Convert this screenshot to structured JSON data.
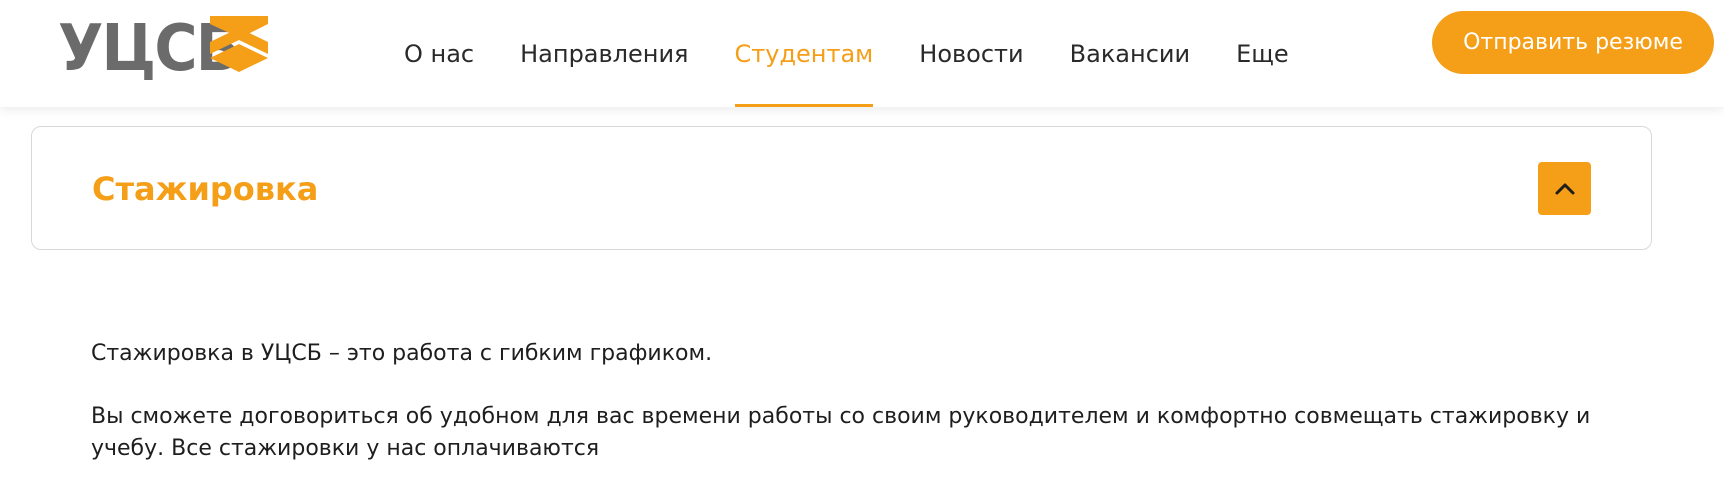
{
  "header": {
    "logo_text": "УЦСБ",
    "nav": [
      {
        "label": "О нас",
        "active": false
      },
      {
        "label": "Направления",
        "active": false
      },
      {
        "label": "Студентам",
        "active": true
      },
      {
        "label": "Новости",
        "active": false
      },
      {
        "label": "Вакансии",
        "active": false
      },
      {
        "label": "Еще",
        "active": false
      }
    ],
    "cta_label": "Отправить резюме"
  },
  "accordion": {
    "title": "Стажировка",
    "toggle_icon": "chevron-up-icon",
    "expanded": true
  },
  "content": {
    "paragraphs": [
      "Стажировка в УЦСБ – это работа с гибким графиком.",
      "Вы сможете договориться об удобном для вас времени работы со своим руководителем и комфортно совмещать стажировку и учебу. Все стажировки у нас оплачиваются"
    ]
  },
  "colors": {
    "accent": "#f59e18",
    "logo_gray": "#6b6b6b",
    "text": "#1e1e1e",
    "border": "#d8d8d8"
  }
}
